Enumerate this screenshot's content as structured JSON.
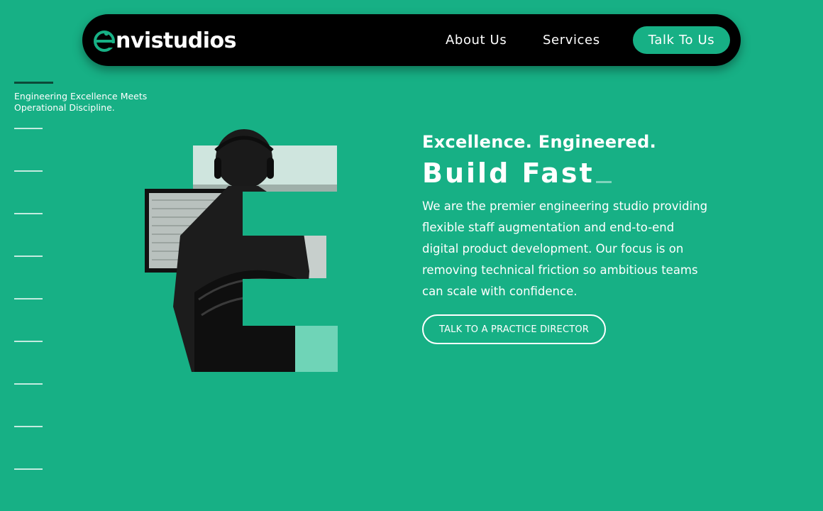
{
  "brand": {
    "name": "nvistudios",
    "accent_color": "#17b085",
    "dark_color": "#000000"
  },
  "nav": {
    "about_label": "About Us",
    "services_label": "Services",
    "cta_label": "Talk To Us"
  },
  "rail": {
    "caption": "Engineering Excellence Meets Operational Discipline.",
    "marker_count": 9
  },
  "hero": {
    "eyebrow": "Excellence. Engineered.",
    "headline": "Build Fast",
    "body": "We are the premier engineering studio providing flexible staff augmentation and end-to-end digital product development. Our focus is on removing technical friction so ambitious teams can scale with confidence.",
    "cta_label": "TALK TO A PRACTICE DIRECTOR",
    "image_icon": "developer-at-monitors-e-mask"
  }
}
